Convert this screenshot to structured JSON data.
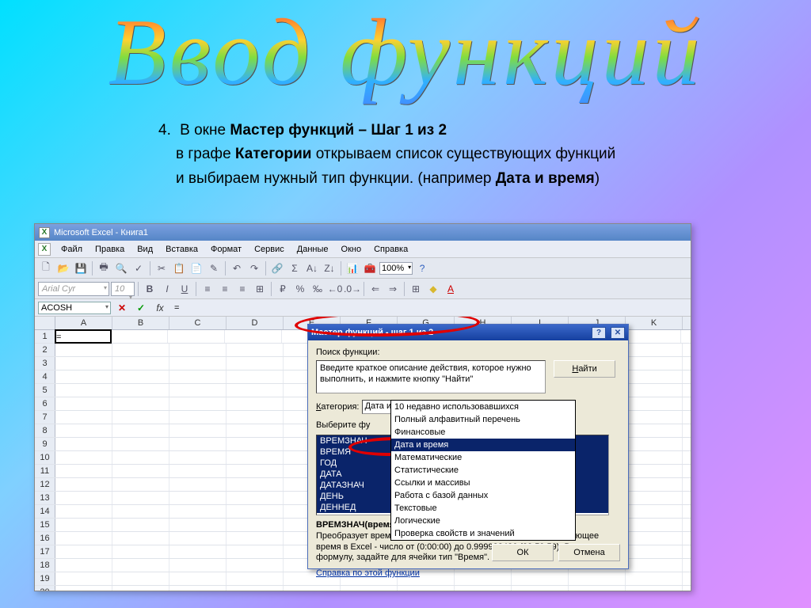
{
  "slide": {
    "title": "Ввод функций",
    "bullet_num": "4.",
    "line1_a": "В окне ",
    "line1_b": "Мастер функций – Шаг 1 из 2",
    "line2_a": "в графе ",
    "line2_b": "Категории",
    "line2_c": " открываем список существующих функций",
    "line3_a": "и выбираем нужный тип функции. (например ",
    "line3_b": "Дата и время",
    "line3_c": ")"
  },
  "excel": {
    "title": "Microsoft Excel - Книга1",
    "menu": [
      "Файл",
      "Правка",
      "Вид",
      "Вставка",
      "Формат",
      "Сервис",
      "Данные",
      "Окно",
      "Справка"
    ],
    "zoom": "100%",
    "font_name": "Arial Cyr",
    "font_size": "10",
    "namebox": "ACOSH",
    "formula_icons": {
      "cancel": "✕",
      "ok": "✓",
      "fx": "fx"
    },
    "formula_value": "=",
    "columns": [
      "A",
      "B",
      "C",
      "D",
      "E",
      "F",
      "G",
      "H",
      "I",
      "J",
      "K"
    ],
    "rows": 20,
    "cell_a1": "="
  },
  "toolbar_icons": [
    "🗋",
    "📂",
    "💾",
    "🖶",
    "🔍",
    "✓",
    "✂",
    "📋",
    "📄",
    "✎",
    "↶",
    "↷",
    "🔗",
    "Σ",
    "A↓",
    "Z↓",
    "📊",
    "🧰"
  ],
  "format_icons": [
    "B",
    "I",
    "U",
    "≡",
    "≡",
    "≡",
    "⊞",
    "%",
    "‰",
    "←0",
    ".0→",
    "⇐",
    "⇒",
    "⊞",
    "◆",
    "A"
  ],
  "wizard": {
    "title": "Мастер функций - шаг 1 из 2",
    "help": "?",
    "close": "✕",
    "search_label": "Поиск функции:",
    "search_text": "Введите краткое описание действия, которое нужно выполнить, и нажмите кнопку \"Найти\"",
    "find_btn": "Найти",
    "category_label": "Категория:",
    "category_value": "Дата и время",
    "select_label_partial": "Выберите фу",
    "dropdown": [
      "10 недавно использовавшихся",
      "Полный алфавитный перечень",
      "Финансовые",
      "Дата и время",
      "Математические",
      "Статистические",
      "Ссылки и массивы",
      "Работа с базой данных",
      "Текстовые",
      "Логические",
      "Проверка свойств и значений"
    ],
    "dropdown_highlight_index": 3,
    "funclist": [
      "ВРЕМЗНАЧ",
      "ВРЕМЯ",
      "ГОД",
      "ДАТА",
      "ДАТАЗНАЧ",
      "ДЕНЬ",
      "ДЕННЕД"
    ],
    "desc_head": "ВРЕМЗНАЧ(время_как_текст)",
    "desc_body": "Преобразует время из текстового формата в число, представляющее время в Excel - число от (0:00:00) до 0.999988426 (23:59:59). Введя формулу, задайте для ячейки тип \"Время\".",
    "link": "Справка по этой функции",
    "ok": "ОК",
    "cancel": "Отмена"
  }
}
